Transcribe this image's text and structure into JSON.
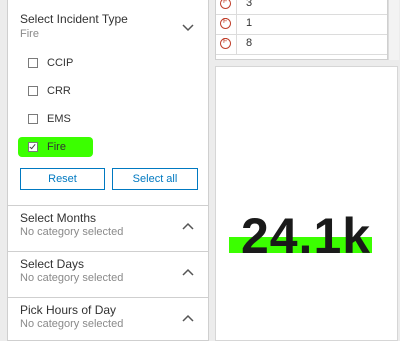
{
  "filters": {
    "incident_type": {
      "title": "Select Incident Type",
      "selected": "Fire",
      "options": [
        {
          "label": "CCIP",
          "checked": false
        },
        {
          "label": "CRR",
          "checked": false
        },
        {
          "label": "EMS",
          "checked": false
        },
        {
          "label": "Fire",
          "checked": true
        }
      ],
      "reset_label": "Reset",
      "select_all_label": "Select all"
    },
    "months": {
      "title": "Select Months",
      "subtitle": "No category selected"
    },
    "days": {
      "title": "Select Days",
      "subtitle": "No category selected"
    },
    "hours": {
      "title": "Pick Hours of Day",
      "subtitle": "No category selected"
    }
  },
  "table": {
    "rows": [
      {
        "value": "3"
      },
      {
        "value": "1"
      },
      {
        "value": "8"
      }
    ]
  },
  "indicator": {
    "value": "24.1k"
  },
  "colors": {
    "highlight": "#3bff00",
    "accent": "#0079c1",
    "fire_icon": "#c0402c"
  }
}
